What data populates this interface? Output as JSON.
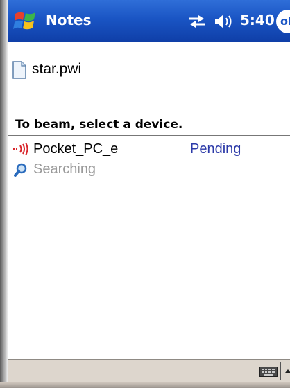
{
  "titlebar": {
    "app_title": "Notes",
    "time": "5:40",
    "ok_label": "ok",
    "start_icon": "windows-flag-icon",
    "connectivity_icon": "connectivity-icon",
    "volume_icon": "speaker-icon",
    "accent_color": "#1a55c4"
  },
  "file": {
    "name": "star.pwi",
    "icon": "document-icon"
  },
  "beam": {
    "heading": "To beam, select a device.",
    "devices": [
      {
        "name": "Pocket_PC_e",
        "status": "Pending",
        "icon": "infrared-icon",
        "status_color": "#2c3aa8"
      }
    ],
    "searching_label": "Searching",
    "searching_icon": "magnifier-icon"
  },
  "menubar": {
    "input_icon": "keyboard-icon",
    "input_menu_icon": "up-arrow-icon",
    "background_color": "#ddd6cd"
  }
}
